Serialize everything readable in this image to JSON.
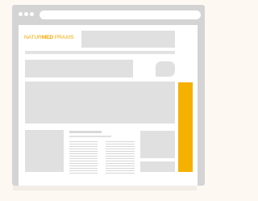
{
  "logo": {
    "natur": "NATUR",
    "med": "MED",
    "praxis": " PRAXIS"
  },
  "colors": {
    "accent": "#f5b100",
    "logo_text": "#f2a900",
    "window_frame": "#d4d4d4",
    "placeholder_block": "#e0e0e0",
    "background": "#fdf8f2"
  }
}
